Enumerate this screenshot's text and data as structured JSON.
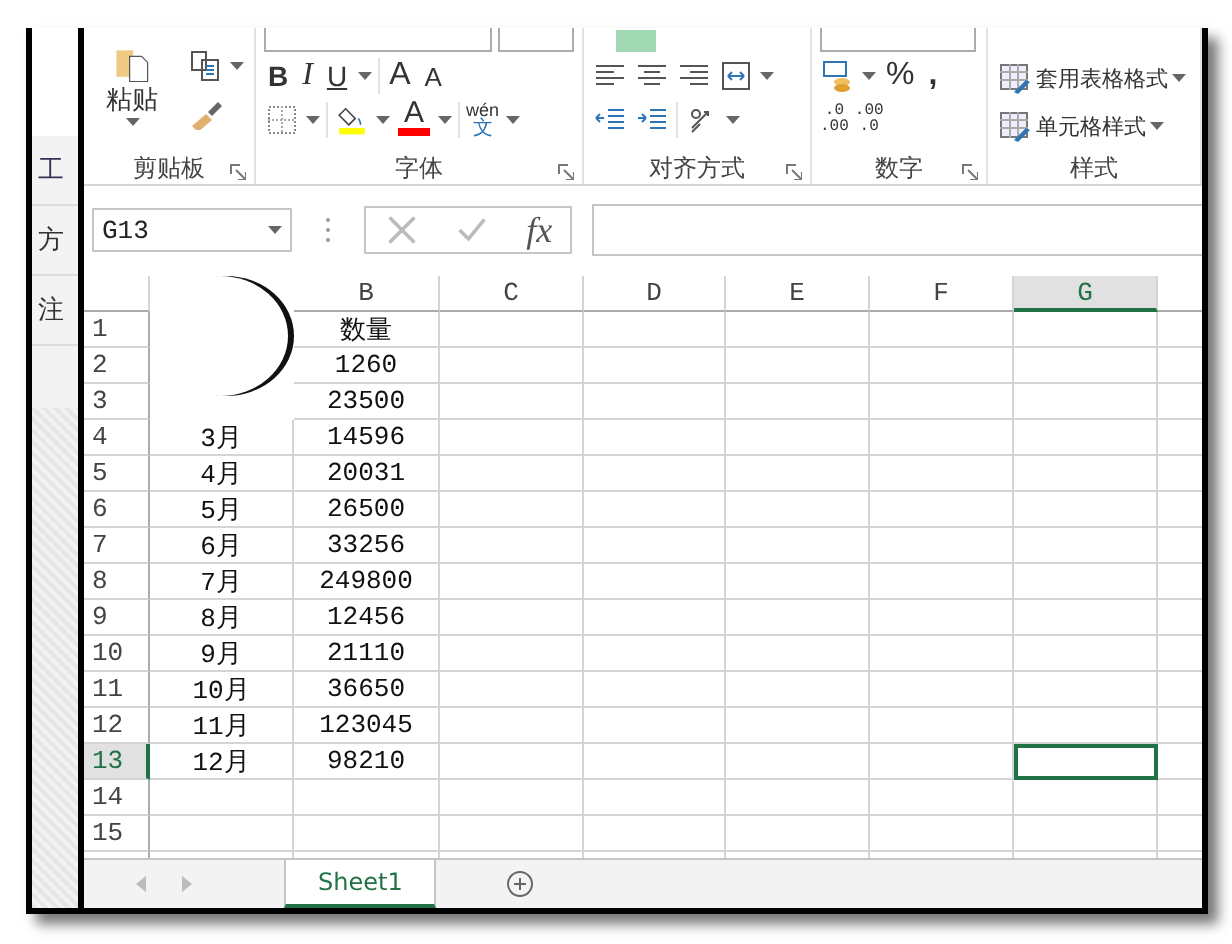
{
  "behind_window": {
    "labels": [
      "工",
      "方",
      "注"
    ]
  },
  "ribbon": {
    "clipboard": {
      "label": "剪贴板",
      "paste": "粘贴"
    },
    "font": {
      "label": "字体",
      "bold": "B",
      "italic": "I",
      "underline": "U",
      "grow": "A",
      "shrink": "A",
      "font_color": "A",
      "phonetic": "wén",
      "phonetic_char": "文"
    },
    "alignment": {
      "label": "对齐方式"
    },
    "number": {
      "label": "数字",
      "percent": "%",
      "comma": ",",
      "increase_decimal": [
        ".0",
        ".00"
      ],
      "decrease_decimal": [
        ".00",
        ".0"
      ]
    },
    "styles": {
      "label": "样式",
      "buttons": [
        "套用表格格式",
        "单元格样式"
      ]
    }
  },
  "formula_bar": {
    "name_box": "G13",
    "fx": "fx"
  },
  "sheet": {
    "columns": [
      {
        "selected": false
      },
      {
        "label": "B",
        "selected": false
      },
      {
        "label": "C",
        "selected": false
      },
      {
        "label": "D",
        "selected": false
      },
      {
        "label": "E",
        "selected": false
      },
      {
        "label": "F",
        "selected": false
      },
      {
        "label": "G",
        "selected": true
      }
    ],
    "rows": [
      {
        "header": "1",
        "selected": false,
        "cells": [
          null,
          "数量"
        ]
      },
      {
        "header": "2",
        "selected": false,
        "cells": [
          null,
          "1260"
        ]
      },
      {
        "header": "3",
        "selected": false,
        "cells": [
          null,
          "23500"
        ]
      },
      {
        "header": "4",
        "selected": false,
        "cells": [
          "3月",
          "14596"
        ]
      },
      {
        "header": "5",
        "selected": false,
        "cells": [
          "4月",
          "20031"
        ]
      },
      {
        "header": "6",
        "selected": false,
        "cells": [
          "5月",
          "26500"
        ]
      },
      {
        "header": "7",
        "selected": false,
        "cells": [
          "6月",
          "33256"
        ]
      },
      {
        "header": "8",
        "selected": false,
        "cells": [
          "7月",
          "249800"
        ]
      },
      {
        "header": "9",
        "selected": false,
        "cells": [
          "8月",
          "12456"
        ]
      },
      {
        "header": "10",
        "selected": false,
        "cells": [
          "9月",
          "21110"
        ]
      },
      {
        "header": "11",
        "selected": false,
        "cells": [
          "10月",
          "36650"
        ]
      },
      {
        "header": "12",
        "selected": false,
        "cells": [
          "11月",
          "123045"
        ]
      },
      {
        "header": "13",
        "selected": true,
        "cells": [
          "12月",
          "98210"
        ]
      },
      {
        "header": "14",
        "selected": false,
        "cells": []
      },
      {
        "header": "15",
        "selected": false,
        "cells": []
      }
    ]
  },
  "sheet_tabs": [
    {
      "label": "Sheet1",
      "selected": true
    }
  ]
}
